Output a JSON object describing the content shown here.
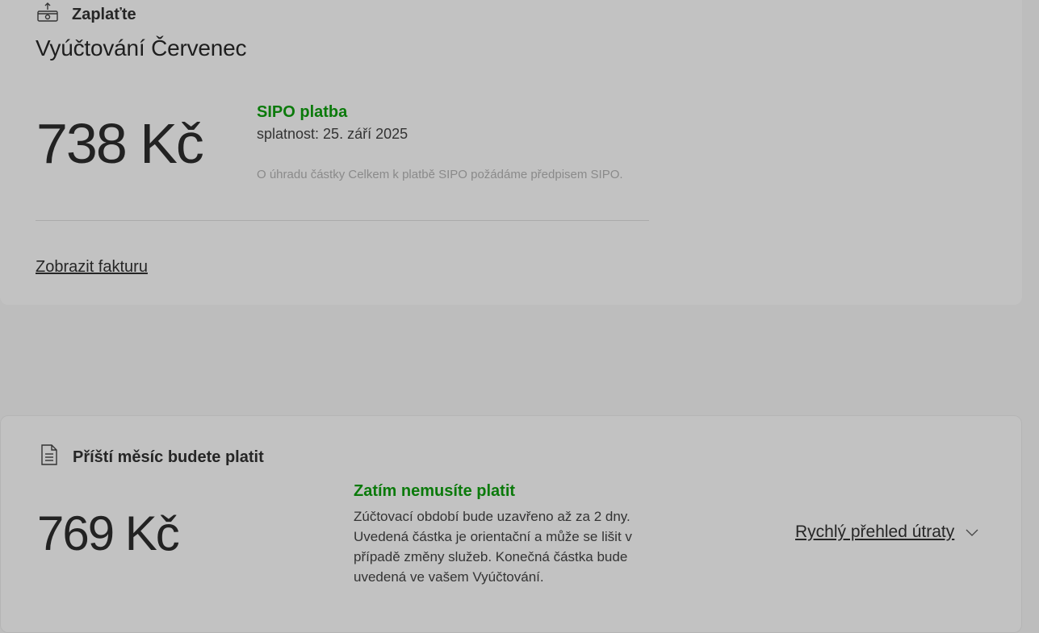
{
  "pay_card": {
    "header": "Zaplaťte",
    "bill_title": "Vyúčtování Červenec",
    "amount": "738 Kč",
    "status": "SIPO platba",
    "due": "splatnost: 25. září 2025",
    "note": "O úhradu částky Celkem k platbě SIPO požádáme předpisem SIPO.",
    "invoice_link": "Zobrazit fakturu"
  },
  "next_card": {
    "header": "Příští měsíc budete platit",
    "amount": "769 Kč",
    "status": "Zatím nemusíte platit",
    "description": "Zúčtovací období bude uzavřeno až za 2 dny. Uvedená částka je orientační a může se lišit v případě změny služeb. Konečná částka bude uvedená ve vašem Vyúčtování.",
    "quick_overview": "Rychlý přehled útraty"
  },
  "colors": {
    "background": "#bdbdbd",
    "card": "#c2c2c2",
    "status_green": "#0b7a0b"
  },
  "icons": [
    "money-pay-icon",
    "document-icon",
    "chevron-down-icon"
  ]
}
